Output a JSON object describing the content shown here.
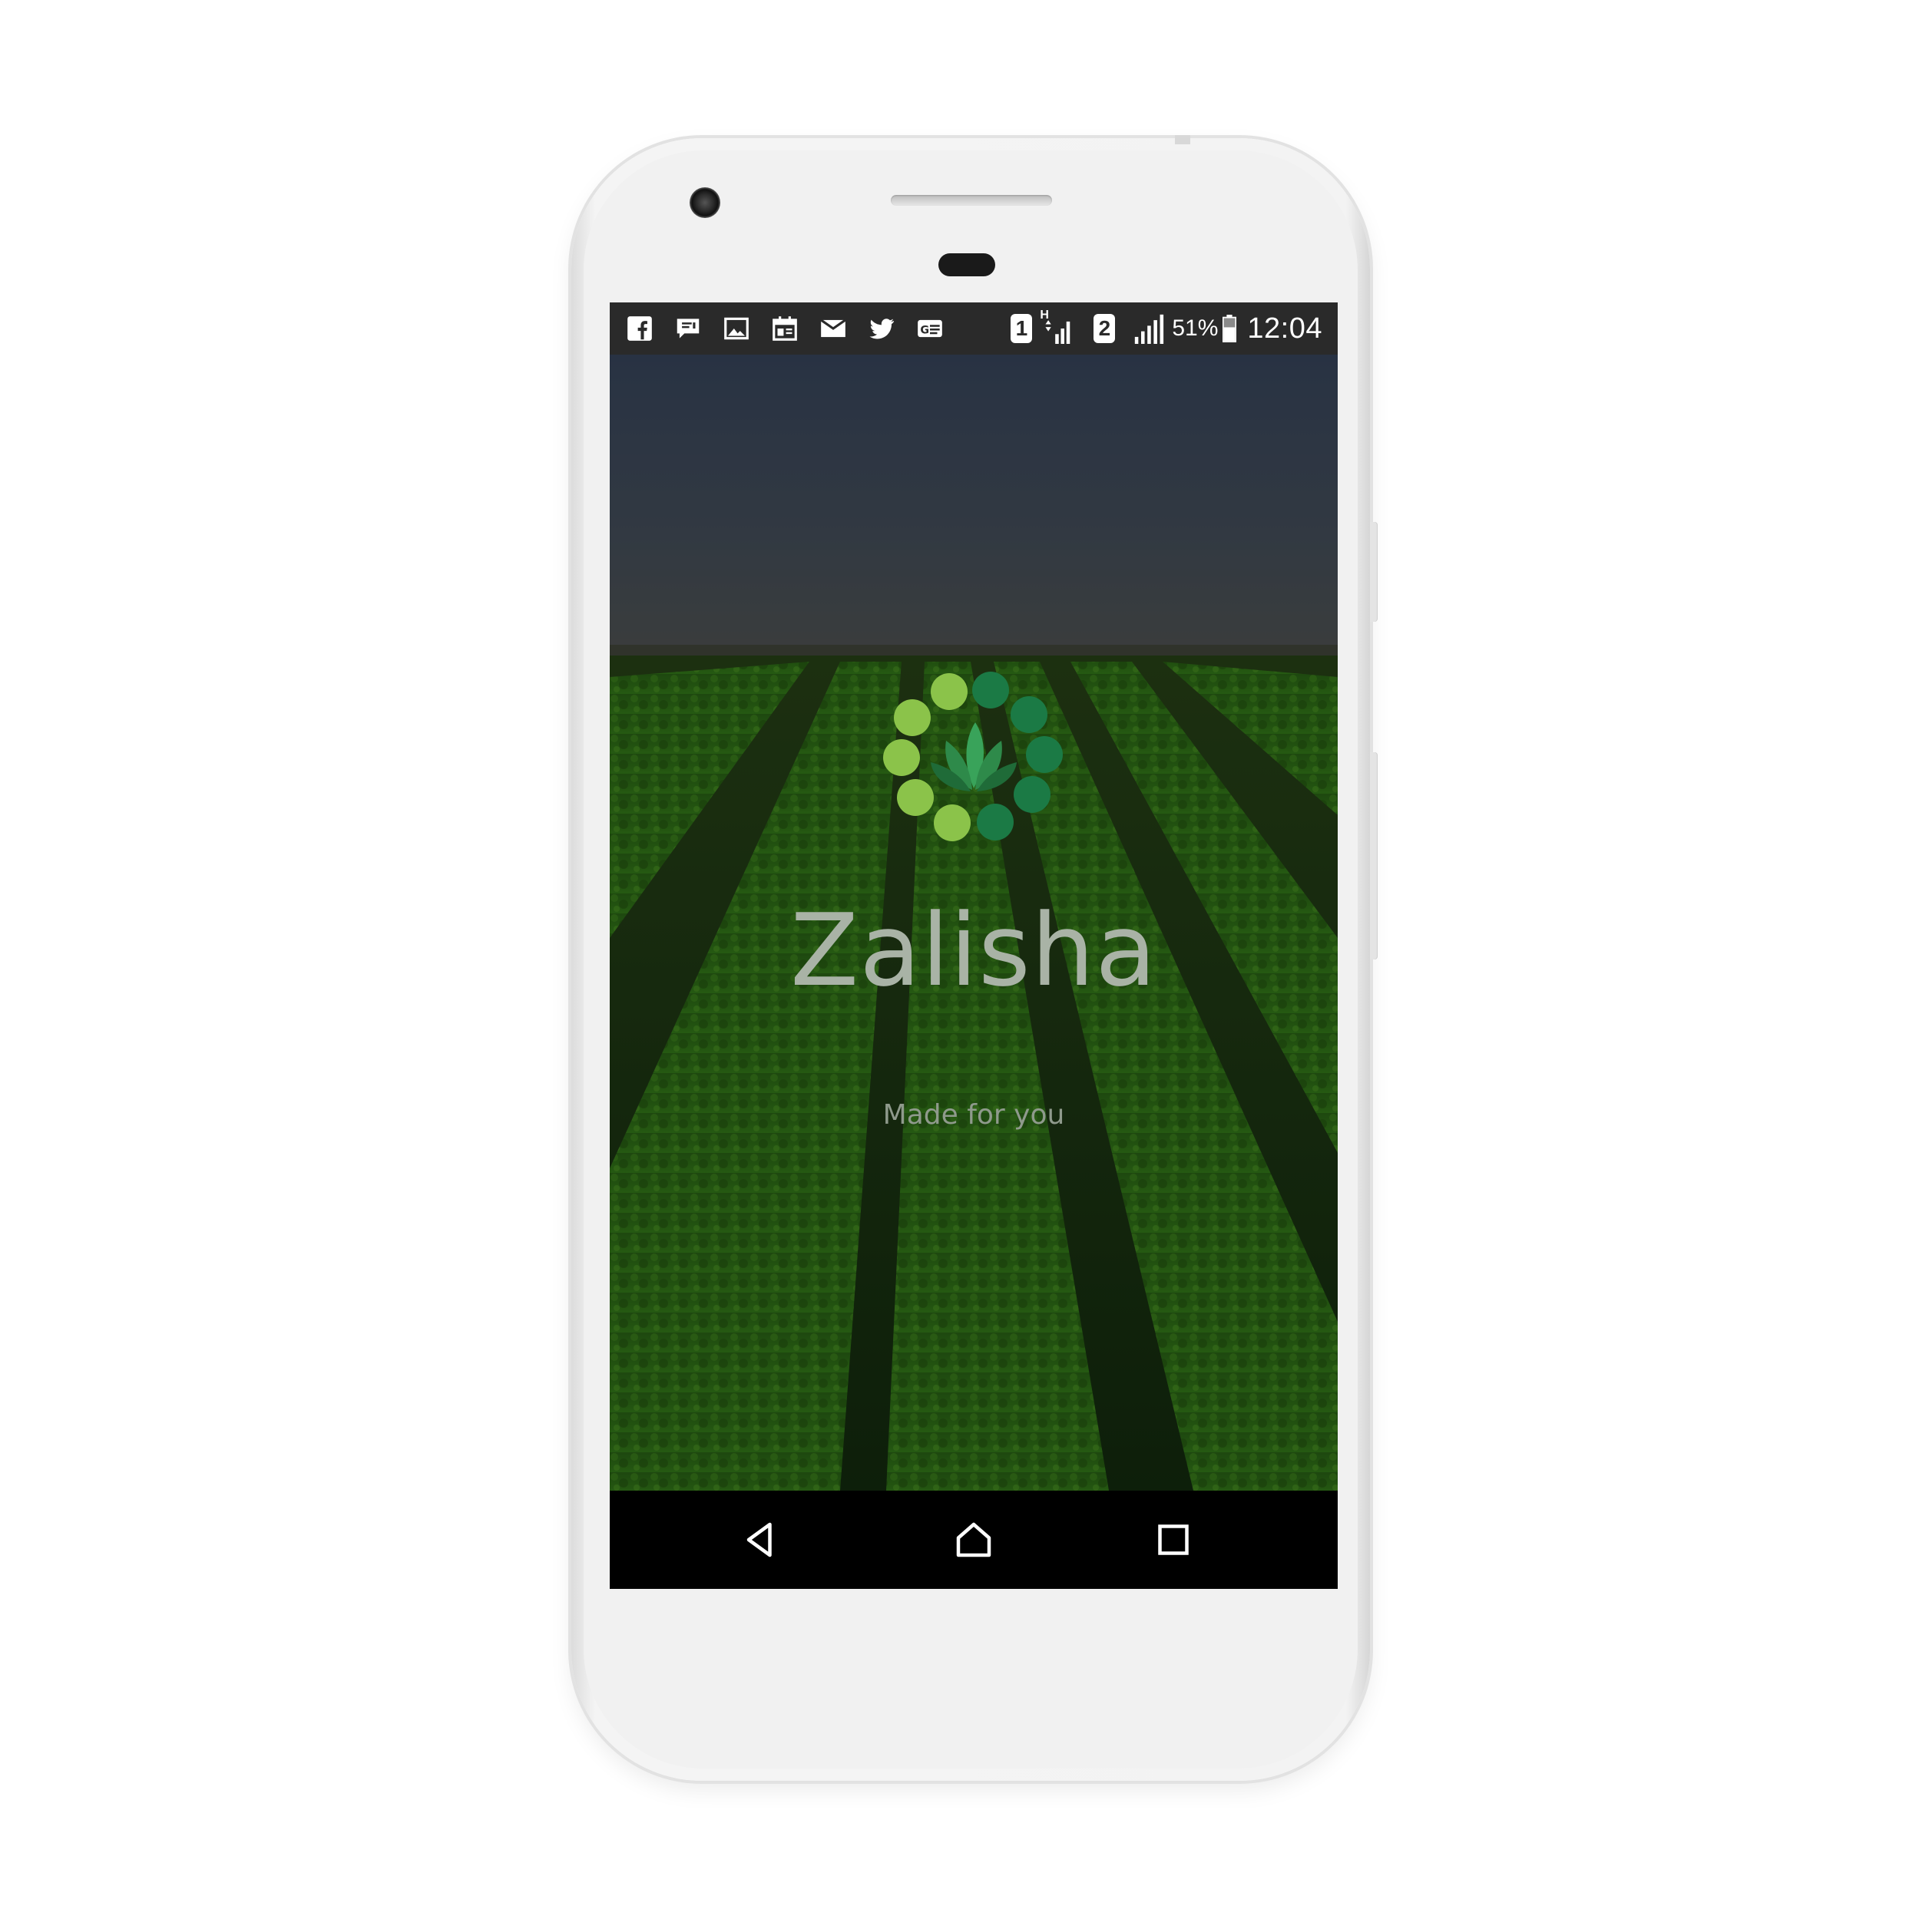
{
  "status_bar": {
    "notification_icons": [
      "facebook-icon",
      "message-icon",
      "image-icon",
      "calendar-icon",
      "email-icon",
      "twitter-icon",
      "news-icon"
    ],
    "sim1_label": "1",
    "sim1_network": "H",
    "sim2_label": "2",
    "battery_percent": "51%",
    "time": "12:04"
  },
  "app": {
    "title": "Zalisha",
    "tagline": "Made for you"
  },
  "nav": {
    "back": "back-icon",
    "home": "home-icon",
    "recents": "recents-icon"
  },
  "colors": {
    "status_bar_bg": "#2a2a2a",
    "logo_light_green": "#8bc34a",
    "logo_dark_green": "#1b7a45",
    "title_text": "#a9b3a6"
  }
}
